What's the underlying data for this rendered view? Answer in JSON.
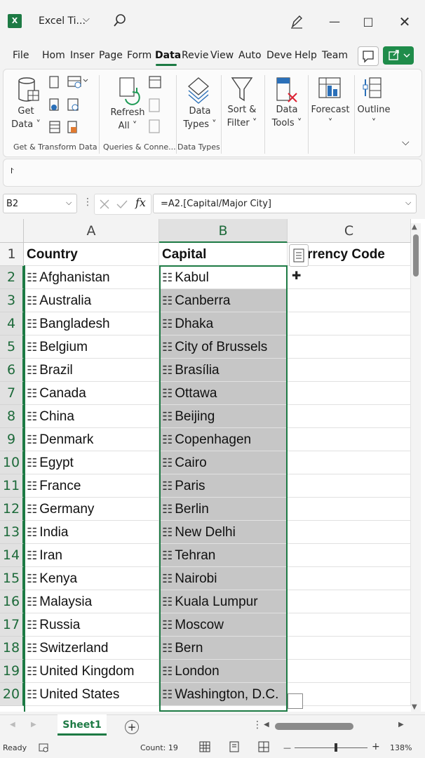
{
  "app": {
    "title": "Excel Ti...",
    "icons": {
      "logo": "excel-logo-icon",
      "search": "search-icon",
      "pen": "pen-icon",
      "minimize": "minimize-icon",
      "maximize": "maximize-icon",
      "close": "close-icon"
    }
  },
  "tabs": [
    {
      "label": "File"
    },
    {
      "label": "Hom"
    },
    {
      "label": "Inser"
    },
    {
      "label": "Page"
    },
    {
      "label": "Form"
    },
    {
      "label": "Data"
    },
    {
      "label": "Revie"
    },
    {
      "label": "View"
    },
    {
      "label": "Auto"
    },
    {
      "label": "Deve"
    },
    {
      "label": "Help"
    },
    {
      "label": "Team"
    }
  ],
  "active_tab": "Data",
  "ribbon": {
    "get_data": {
      "line1": "Get",
      "line2": "Data ˅"
    },
    "refresh_all": {
      "line1": "Refresh",
      "line2": "All ˅"
    },
    "data_types": {
      "line1": "Data",
      "line2": "Types ˅"
    },
    "sort_filter": {
      "line1": "Sort &",
      "line2": "Filter ˅"
    },
    "data_tools": {
      "line1": "Data",
      "line2": "Tools ˅"
    },
    "forecast": {
      "line1": "Forecast",
      "line2": "˅"
    },
    "outline": {
      "line1": "Outline",
      "line2": "˅"
    },
    "groups": [
      "Get & Transform Data",
      "Queries & Conne...",
      "Data Types"
    ],
    "accent": "#1d7a44"
  },
  "formula_bar": {
    "name_box": "B2",
    "fx": "fx",
    "formula": "=A2.[Capital/Major City]"
  },
  "sheet": {
    "columns": [
      "A",
      "B",
      "C"
    ],
    "header_row": {
      "a": "Country",
      "b": "Capital",
      "c": "rrency Code"
    },
    "rows": [
      {
        "num": "1"
      },
      {
        "num": "2",
        "a": "Afghanistan",
        "b": "Kabul"
      },
      {
        "num": "3",
        "a": "Australia",
        "b": "Canberra"
      },
      {
        "num": "4",
        "a": "Bangladesh",
        "b": "Dhaka"
      },
      {
        "num": "5",
        "a": "Belgium",
        "b": "City of Brussels"
      },
      {
        "num": "6",
        "a": "Brazil",
        "b": "Brasília"
      },
      {
        "num": "7",
        "a": "Canada",
        "b": "Ottawa"
      },
      {
        "num": "8",
        "a": "China",
        "b": "Beijing"
      },
      {
        "num": "9",
        "a": "Denmark",
        "b": "Copenhagen"
      },
      {
        "num": "10",
        "a": "Egypt",
        "b": "Cairo"
      },
      {
        "num": "11",
        "a": "France",
        "b": "Paris"
      },
      {
        "num": "12",
        "a": "Germany",
        "b": "Berlin"
      },
      {
        "num": "13",
        "a": "India",
        "b": "New Delhi"
      },
      {
        "num": "14",
        "a": "Iran",
        "b": "Tehran"
      },
      {
        "num": "15",
        "a": "Kenya",
        "b": "Nairobi"
      },
      {
        "num": "16",
        "a": "Malaysia",
        "b": "Kuala Lumpur"
      },
      {
        "num": "17",
        "a": "Russia",
        "b": "Moscow"
      },
      {
        "num": "18",
        "a": "Switzerland",
        "b": "Bern"
      },
      {
        "num": "19",
        "a": "United Kingdom",
        "b": "London"
      },
      {
        "num": "20",
        "a": "United States",
        "b": "Washington, D.C."
      }
    ],
    "sheet_tab": "Sheet1",
    "map_icon": "map-icon"
  },
  "status": {
    "ready": "Ready",
    "count": "Count: 19",
    "zoom": "138%",
    "minus": "—",
    "plus": "+"
  }
}
